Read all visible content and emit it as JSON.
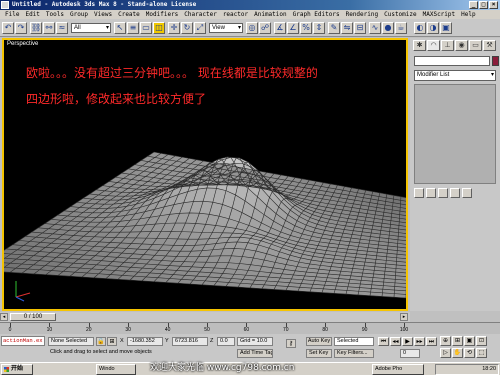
{
  "window": {
    "title": "Untitled - Autodesk 3ds Max 8 - Stand-alone License",
    "controls": [
      "_",
      "□",
      "×"
    ]
  },
  "menubar": [
    "File",
    "Edit",
    "Tools",
    "Group",
    "Views",
    "Create",
    "Modifiers",
    "Character",
    "reactor",
    "Animation",
    "Graph Editors",
    "Rendering",
    "Customize",
    "MAXScript",
    "Help"
  ],
  "toolbar": {
    "selection_filter": "All",
    "reference_coord": "View"
  },
  "viewport": {
    "label": "Perspective",
    "annotation_line1": "欧啦。。。没有超过三分钟吧。。。   现在线都是比较规整的",
    "annotation_line2": "四边形啦，修改起来也比较方便了",
    "annotation_color": "#ff2a2a",
    "border_color": "#f5c400"
  },
  "command_panel": {
    "name_value": "",
    "modifier_list": "Modifier List",
    "object_color": "#8a1c3a"
  },
  "timeline": {
    "slider_label": "0 / 100",
    "ticks": [
      "0",
      "10",
      "20",
      "30",
      "40",
      "50",
      "60",
      "70",
      "80",
      "90",
      "100"
    ]
  },
  "status": {
    "maxscript_text": "actionMan.ex",
    "selection_count": "None Selected",
    "x_label": "X",
    "x_value": "-1680.352",
    "y_label": "Y",
    "y_value": "6723.816",
    "z_label": "Z",
    "z_value": "0.0",
    "grid": "Grid = 10.0",
    "prompt": "Click and drag to select and move objects",
    "add_time_tag": "Add Time Tag",
    "auto_key": "Auto Key",
    "set_key": "Set Key",
    "selected_option": "Selected",
    "key_filters": "Key Filters...",
    "frame_value": "0"
  },
  "taskbar": {
    "start_label": "开始",
    "items": [
      "Windo",
      "Adobe Pho"
    ],
    "watermark": "欢迎大家光临  www.cg798.com.cn",
    "clock": "18:20"
  }
}
